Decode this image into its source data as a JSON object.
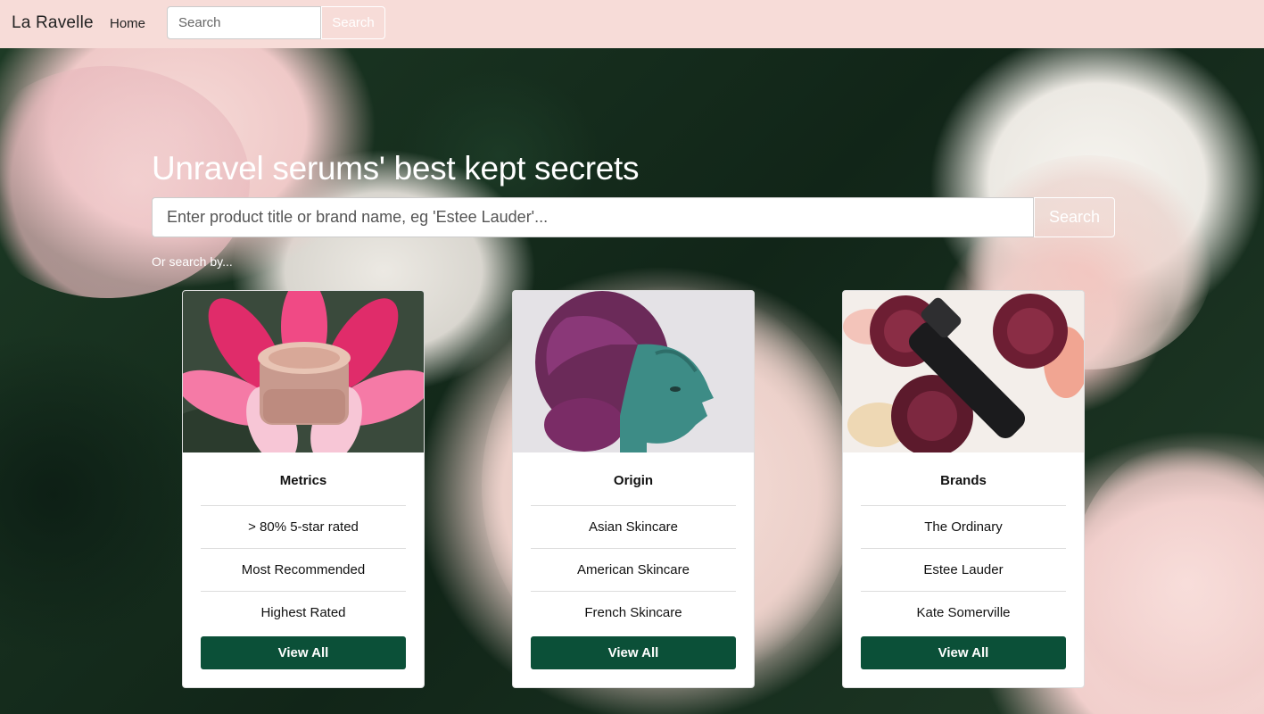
{
  "navbar": {
    "brand": "La Ravelle",
    "home_label": "Home",
    "search_placeholder": "Search",
    "search_button": "Search"
  },
  "hero": {
    "title": "Unravel serums' best kept secrets",
    "search_placeholder": "Enter product title or brand name, eg 'Estee Lauder'...",
    "search_button": "Search",
    "or_search_by": "Or search by..."
  },
  "cards": [
    {
      "title": "Metrics",
      "image": "cream-jar-in-pink-flower",
      "items": [
        "> 80% 5-star rated",
        "Most Recommended",
        "Highest Rated"
      ],
      "button": "View All"
    },
    {
      "title": "Origin",
      "image": "woman-profile-portrait",
      "items": [
        "Asian Skincare",
        "American Skincare",
        "French Skincare"
      ],
      "button": "View All"
    },
    {
      "title": "Brands",
      "image": "dried-roses-and-serum-bottle",
      "items": [
        "The Ordinary",
        "Estee Lauder",
        "Kate Somerville"
      ],
      "button": "View All"
    }
  ],
  "colors": {
    "navbar_bg": "#f7dcd8",
    "button_green": "#0b5038"
  }
}
